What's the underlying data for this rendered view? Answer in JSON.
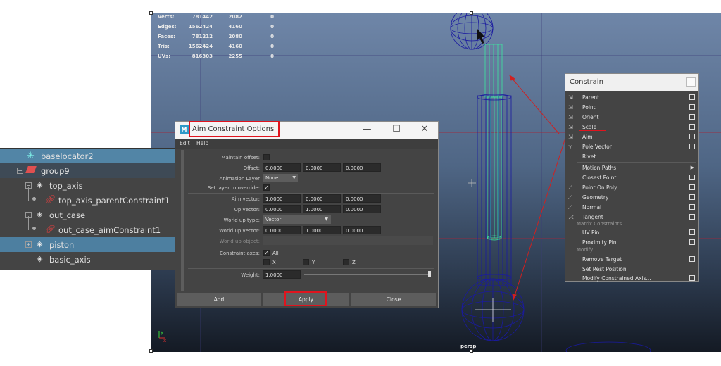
{
  "stats": {
    "rows": [
      {
        "label": "Verts:",
        "v1": "781442",
        "v2": "2082",
        "v3": "0"
      },
      {
        "label": "Edges:",
        "v1": "1562424",
        "v2": "4160",
        "v3": "0"
      },
      {
        "label": "Faces:",
        "v1": "781212",
        "v2": "2080",
        "v3": "0"
      },
      {
        "label": "Tris:",
        "v1": "1562424",
        "v2": "4160",
        "v3": "0"
      },
      {
        "label": "UVs:",
        "v1": "816303",
        "v2": "2255",
        "v3": "0"
      }
    ]
  },
  "viewport": {
    "camera_label": "persp"
  },
  "outliner": {
    "items": [
      {
        "label": "baselocator2"
      },
      {
        "label": "group9"
      },
      {
        "label": "top_axis"
      },
      {
        "label": "top_axis_parentConstraint1"
      },
      {
        "label": "out_case"
      },
      {
        "label": "out_case_aimConstraint1"
      },
      {
        "label": "piston"
      },
      {
        "label": "basic_axis"
      }
    ]
  },
  "dialog": {
    "title": "Aim Constraint Options",
    "menu": {
      "edit": "Edit",
      "help": "Help"
    },
    "maintain_offset_label": "Maintain offset:",
    "offset_label": "Offset:",
    "offset": [
      "0.0000",
      "0.0000",
      "0.0000"
    ],
    "animation_layer_label": "Animation Layer",
    "animation_layer_value": "None",
    "set_layer_label": "Set layer to override:",
    "aim_vector_label": "Aim vector:",
    "aim_vector": [
      "1.0000",
      "0.0000",
      "0.0000"
    ],
    "up_vector_label": "Up vector:",
    "up_vector": [
      "0.0000",
      "1.0000",
      "0.0000"
    ],
    "world_up_type_label": "World up type:",
    "world_up_type_value": "Vector",
    "world_up_vector_label": "World up vector:",
    "world_up_vector": [
      "0.0000",
      "1.0000",
      "0.0000"
    ],
    "world_up_object_label": "World up object:",
    "constraint_axes_label": "Constraint axes:",
    "axes": {
      "all": "All",
      "x": "X",
      "y": "Y",
      "z": "Z"
    },
    "weight_label": "Weight:",
    "weight": "1.0000",
    "buttons": {
      "add": "Add",
      "apply": "Apply",
      "close": "Close"
    }
  },
  "constrain_menu": {
    "title": "Constrain",
    "items": [
      {
        "label": "Parent",
        "box": true
      },
      {
        "label": "Point",
        "box": true
      },
      {
        "label": "Orient",
        "box": true
      },
      {
        "label": "Scale",
        "box": true
      },
      {
        "label": "Aim",
        "box": true
      },
      {
        "label": "Pole Vector",
        "box": true
      },
      {
        "label": "Rivet",
        "box": false
      }
    ],
    "items2": [
      {
        "label": "Motion Paths",
        "arrow": true
      },
      {
        "label": "Closest Point",
        "box": true
      },
      {
        "label": "Point On Poly",
        "box": true
      },
      {
        "label": "Geometry",
        "box": true
      },
      {
        "label": "Normal",
        "box": true
      },
      {
        "label": "Tangent",
        "box": true
      }
    ],
    "section_matrix": "Matrix Constraints",
    "items3": [
      {
        "label": "UV Pin",
        "box": true
      },
      {
        "label": "Proximity Pin",
        "box": true
      }
    ],
    "section_modify": "Modify",
    "items4": [
      {
        "label": "Remove Target",
        "box": true
      },
      {
        "label": "Set Rest Position",
        "box": false
      },
      {
        "label": "Modify Constrained Axis...",
        "box": true
      }
    ]
  },
  "colors": {
    "highlight": "#e0141e",
    "selection": "#5285a6",
    "wire": "#1a1aa0",
    "wire_selected": "#3de8a0"
  }
}
